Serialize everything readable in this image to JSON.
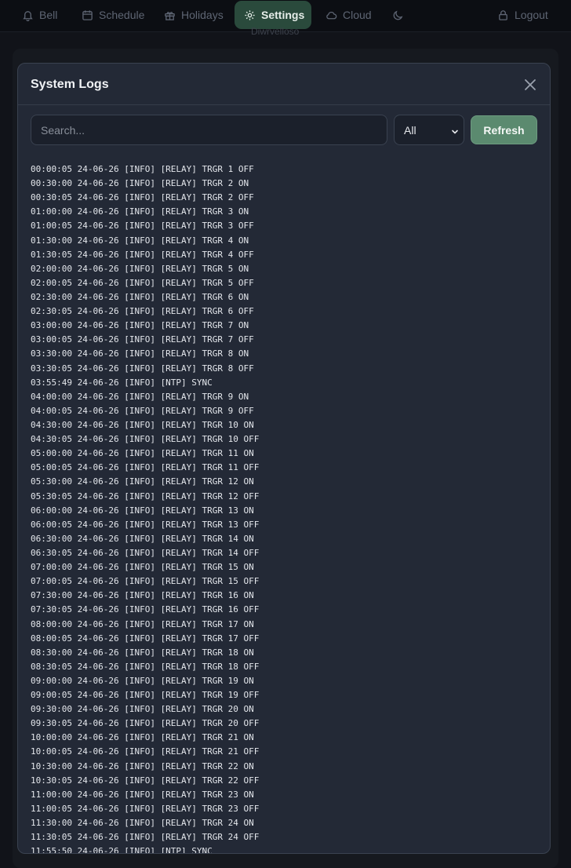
{
  "nav": {
    "items": [
      {
        "key": "bell",
        "label": "Bell",
        "icon": "bell-icon"
      },
      {
        "key": "schedule",
        "label": "Schedule",
        "icon": "calendar-icon"
      },
      {
        "key": "holidays",
        "label": "Holidays",
        "icon": "gift-icon"
      },
      {
        "key": "settings",
        "label": "Settings",
        "icon": "gear-icon"
      },
      {
        "key": "cloud",
        "label": "Cloud",
        "icon": "cloud-icon"
      }
    ],
    "theme_icon": "moon-icon",
    "logout_label": "Logout",
    "logout_icon": "lock-icon",
    "active": "settings"
  },
  "background": {
    "partial_text": "Diwrvelloso"
  },
  "modal": {
    "title": "System Logs",
    "close_icon": "close-icon",
    "search": {
      "placeholder": "Search...",
      "value": ""
    },
    "level_filter": {
      "selected": "All"
    },
    "refresh_label": "Refresh"
  },
  "logs": [
    "00:00:05 24-06-26 [INFO] [RELAY] TRGR 1 OFF",
    "00:30:00 24-06-26 [INFO] [RELAY] TRGR 2 ON",
    "00:30:05 24-06-26 [INFO] [RELAY] TRGR 2 OFF",
    "01:00:00 24-06-26 [INFO] [RELAY] TRGR 3 ON",
    "01:00:05 24-06-26 [INFO] [RELAY] TRGR 3 OFF",
    "01:30:00 24-06-26 [INFO] [RELAY] TRGR 4 ON",
    "01:30:05 24-06-26 [INFO] [RELAY] TRGR 4 OFF",
    "02:00:00 24-06-26 [INFO] [RELAY] TRGR 5 ON",
    "02:00:05 24-06-26 [INFO] [RELAY] TRGR 5 OFF",
    "02:30:00 24-06-26 [INFO] [RELAY] TRGR 6 ON",
    "02:30:05 24-06-26 [INFO] [RELAY] TRGR 6 OFF",
    "03:00:00 24-06-26 [INFO] [RELAY] TRGR 7 ON",
    "03:00:05 24-06-26 [INFO] [RELAY] TRGR 7 OFF",
    "03:30:00 24-06-26 [INFO] [RELAY] TRGR 8 ON",
    "03:30:05 24-06-26 [INFO] [RELAY] TRGR 8 OFF",
    "03:55:49 24-06-26 [INFO] [NTP] SYNC",
    "04:00:00 24-06-26 [INFO] [RELAY] TRGR 9 ON",
    "04:00:05 24-06-26 [INFO] [RELAY] TRGR 9 OFF",
    "04:30:00 24-06-26 [INFO] [RELAY] TRGR 10 ON",
    "04:30:05 24-06-26 [INFO] [RELAY] TRGR 10 OFF",
    "05:00:00 24-06-26 [INFO] [RELAY] TRGR 11 ON",
    "05:00:05 24-06-26 [INFO] [RELAY] TRGR 11 OFF",
    "05:30:00 24-06-26 [INFO] [RELAY] TRGR 12 ON",
    "05:30:05 24-06-26 [INFO] [RELAY] TRGR 12 OFF",
    "06:00:00 24-06-26 [INFO] [RELAY] TRGR 13 ON",
    "06:00:05 24-06-26 [INFO] [RELAY] TRGR 13 OFF",
    "06:30:00 24-06-26 [INFO] [RELAY] TRGR 14 ON",
    "06:30:05 24-06-26 [INFO] [RELAY] TRGR 14 OFF",
    "07:00:00 24-06-26 [INFO] [RELAY] TRGR 15 ON",
    "07:00:05 24-06-26 [INFO] [RELAY] TRGR 15 OFF",
    "07:30:00 24-06-26 [INFO] [RELAY] TRGR 16 ON",
    "07:30:05 24-06-26 [INFO] [RELAY] TRGR 16 OFF",
    "08:00:00 24-06-26 [INFO] [RELAY] TRGR 17 ON",
    "08:00:05 24-06-26 [INFO] [RELAY] TRGR 17 OFF",
    "08:30:00 24-06-26 [INFO] [RELAY] TRGR 18 ON",
    "08:30:05 24-06-26 [INFO] [RELAY] TRGR 18 OFF",
    "09:00:00 24-06-26 [INFO] [RELAY] TRGR 19 ON",
    "09:00:05 24-06-26 [INFO] [RELAY] TRGR 19 OFF",
    "09:30:00 24-06-26 [INFO] [RELAY] TRGR 20 ON",
    "09:30:05 24-06-26 [INFO] [RELAY] TRGR 20 OFF",
    "10:00:00 24-06-26 [INFO] [RELAY] TRGR 21 ON",
    "10:00:05 24-06-26 [INFO] [RELAY] TRGR 21 OFF",
    "10:30:00 24-06-26 [INFO] [RELAY] TRGR 22 ON",
    "10:30:05 24-06-26 [INFO] [RELAY] TRGR 22 OFF",
    "11:00:00 24-06-26 [INFO] [RELAY] TRGR 23 ON",
    "11:00:05 24-06-26 [INFO] [RELAY] TRGR 23 OFF",
    "11:30:00 24-06-26 [INFO] [RELAY] TRGR 24 ON",
    "11:30:05 24-06-26 [INFO] [RELAY] TRGR 24 OFF",
    "11:55:50 24-06-26 [INFO] [NTP] SYNC"
  ],
  "colors": {
    "accent": "#5b8a6f",
    "nav_active_bg": "#2a4a3c",
    "modal_bg": "#232936",
    "page_bg": "#111319"
  }
}
